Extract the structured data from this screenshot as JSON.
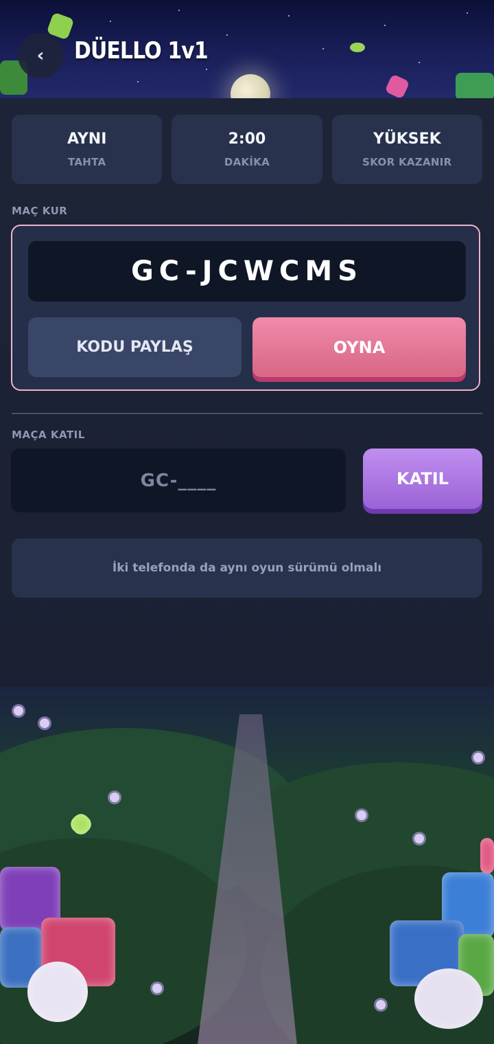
{
  "header": {
    "back_icon": "chevron-left-icon",
    "back_glyph": "‹",
    "title": "DÜELLO 1v1"
  },
  "info_cards": [
    {
      "value": "AYNI",
      "label": "TAHTA"
    },
    {
      "value": "2:00",
      "label": "DAKİKA"
    },
    {
      "value": "YÜKSEK",
      "label": "SKOR KAZANIR"
    }
  ],
  "host": {
    "section_label": "MAÇ KUR",
    "code": "GC-JCWCMS",
    "share_label": "KODU PAYLAŞ",
    "play_label": "OYNA"
  },
  "join": {
    "section_label": "MAÇA KATIL",
    "placeholder": "GC-____",
    "value": "",
    "join_label": "KATIL"
  },
  "notice": "İki telefonda da aynı oyun sürümü olmalı",
  "colors": {
    "accent_pink": "#f08bab",
    "accent_purple": "#b07fe8",
    "panel": "#1d2437",
    "card": "#28324d",
    "host_border": "#f0b2cb"
  }
}
